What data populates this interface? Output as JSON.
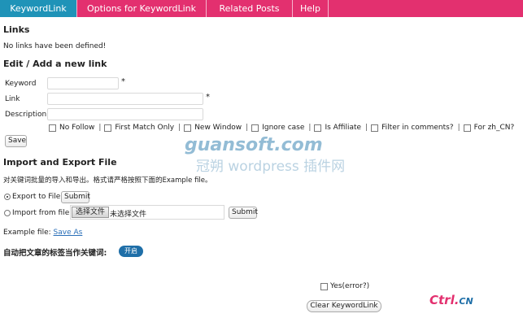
{
  "tabs": [
    {
      "label": "KeywordLink"
    },
    {
      "label": "Options for KeywordLink"
    },
    {
      "label": "Related Posts"
    },
    {
      "label": "Help"
    }
  ],
  "links": {
    "title": "Links",
    "empty_message": "No links have been defined!"
  },
  "edit": {
    "title": "Edit / Add a new link",
    "keyword_label": "Keyword",
    "link_label": "Link",
    "description_label": "Description",
    "required_mark": "*",
    "options": [
      "No Follow",
      "First Match Only",
      "New Window",
      "Ignore case",
      "Is Affiliate",
      "Filter in comments?",
      "For zh_CN?"
    ],
    "separator": "|",
    "save_label": "Save"
  },
  "import_export": {
    "title": "Import and Export File",
    "instructions": "对关键词批量的导入和导出。格式请严格按照下面的Example file。",
    "export_label": "Export to File",
    "import_label": "Import from file",
    "submit_label": "Submit",
    "choose_file_label": "选择文件",
    "no_file_label": "未选择文件",
    "example_prefix": "Example file:",
    "example_link": "Save As"
  },
  "auto_tags": {
    "label": "自动把文章的标签当作关键词:",
    "toggle_label": "开启"
  },
  "clear": {
    "confirm_label": "Yes(error?)",
    "button_label": "Clear KeywordLink"
  },
  "watermark": {
    "line1": "guansoft.com",
    "line2": "冠朔 wordpress 插件网",
    "brand": "Ctrl.",
    "brand_suffix": "CN"
  },
  "colors": {
    "tabbar": "#e3306f",
    "active_tab": "#1f93b8",
    "link": "#2a6fb8"
  }
}
